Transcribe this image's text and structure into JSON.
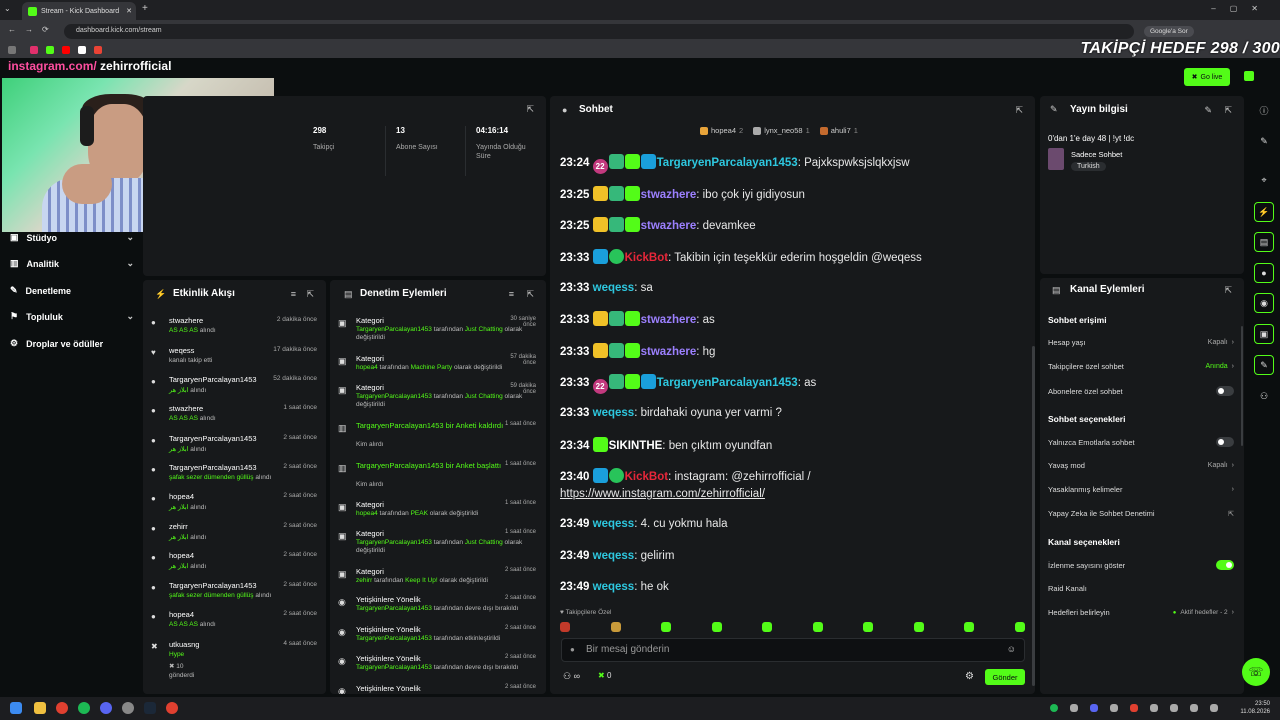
{
  "browser": {
    "tab_title": "Stream - Kick Dashboard",
    "url": "dashboard.kick.com/stream",
    "google_btn": "Google'a Sor"
  },
  "overlay": {
    "follower_goal": "TAKİPÇİ HEDEF 298 / 300",
    "insta_prefix": "instagram.com/",
    "insta_handle": "zehirrofficial"
  },
  "header": {
    "go_live": "Go live"
  },
  "sidebar": {
    "items": [
      {
        "label": "Stüdyo",
        "icon": "video-icon",
        "chevron": "⌄"
      },
      {
        "label": "Analitik",
        "icon": "chart-icon",
        "chevron": "⌄"
      },
      {
        "label": "Denetleme",
        "icon": "wrench-icon",
        "chevron": ""
      },
      {
        "label": "Topluluk",
        "icon": "users-icon",
        "chevron": "⌄"
      },
      {
        "label": "Droplar ve ödüller",
        "icon": "gift-icon",
        "chevron": ""
      }
    ]
  },
  "stats": [
    {
      "value": "298",
      "label": "Takipçi"
    },
    {
      "value": "13",
      "label": "Abone Sayısı"
    },
    {
      "value": "04:16:14",
      "label": "Yayında Olduğu Süre"
    }
  ],
  "activity": {
    "title": "Etkinlik Akışı",
    "items": [
      {
        "name": "stwazhere",
        "time": "2 dakika önce",
        "green": "AS AS AS",
        "rest": " alındı"
      },
      {
        "name": "weqess",
        "time": "17 dakika önce",
        "green": "",
        "rest": "kanalı takip etti"
      },
      {
        "name": "TargaryenParcalayan1453",
        "time": "52 dakika önce",
        "green": "ابلاز هر",
        "rest": " alındı"
      },
      {
        "name": "stwazhere",
        "time": "1 saat önce",
        "green": "AS AS AS",
        "rest": " alındı"
      },
      {
        "name": "TargaryenParcalayan1453",
        "time": "2 saat önce",
        "green": "ابلاز هر",
        "rest": " alındı"
      },
      {
        "name": "TargaryenParcalayan1453",
        "time": "2 saat önce",
        "green": "şafak sezer dümenden güllüş",
        "rest": " alındı"
      },
      {
        "name": "hopea4",
        "time": "2 saat önce",
        "green": "ابلاز هر",
        "rest": " alındı"
      },
      {
        "name": "zehirr",
        "time": "2 saat önce",
        "green": "ابلاز هر",
        "rest": " alındı"
      },
      {
        "name": "hopea4",
        "time": "2 saat önce",
        "green": "ابلاز هر",
        "rest": " alındı"
      },
      {
        "name": "TargaryenParcalayan1453",
        "time": "2 saat önce",
        "green": "şafak sezer dümenden güllüş",
        "rest": " alındı"
      },
      {
        "name": "hopea4",
        "time": "2 saat önce",
        "green": "AS AS AS",
        "rest": " alındı"
      },
      {
        "name": "utkuasng",
        "time": "4 saat önce",
        "green": "Hype",
        "rest": "",
        "extra1": "10",
        "extra2": "gönderdi"
      }
    ]
  },
  "moderation": {
    "title": "Denetim Eylemleri",
    "items": [
      {
        "title": "Kategori",
        "time": "30 saniye önce",
        "user": "TargaryenParcalayan1453",
        "mid": " tarafından ",
        "val": "Just Chatting",
        "end": " olarak değiştirildi"
      },
      {
        "title": "Kategori",
        "time": "57 dakika önce",
        "user": "hopea4",
        "mid": " tarafından ",
        "val": "Machine Party",
        "end": " olarak değiştirildi"
      },
      {
        "title": "Kategori",
        "time": "59 dakika önce",
        "user": "TargaryenParcalayan1453",
        "mid": " tarafından ",
        "val": "Just Chatting",
        "end": " olarak değiştirildi"
      },
      {
        "title": "TargaryenParcalayan1453 bir Anketi kaldırdı",
        "time": "1 saat önce",
        "sub": "Kim alırdı"
      },
      {
        "title": "TargaryenParcalayan1453 bir Anket başlattı",
        "time": "1 saat önce",
        "sub": "Kim alırdı"
      },
      {
        "title": "Kategori",
        "time": "1 saat önce",
        "user": "hopea4",
        "mid": " tarafından ",
        "val": "PEAK",
        "end": " olarak değiştirildi"
      },
      {
        "title": "Kategori",
        "time": "1 saat önce",
        "user": "TargaryenParcalayan1453",
        "mid": " tarafından ",
        "val": "Just Chatting",
        "end": " olarak değiştirildi"
      },
      {
        "title": "Kategori",
        "time": "2 saat önce",
        "user": "zehirr",
        "mid": " tarafından ",
        "val": "Keep It Up!",
        "end": " olarak değiştirildi"
      },
      {
        "title": "Yetişkinlere Yönelik",
        "time": "2 saat önce",
        "user": "TargaryenParcalayan1453",
        "mid": " tarafından devre dışı bırakıldı",
        "val": "",
        "end": ""
      },
      {
        "title": "Yetişkinlere Yönelik",
        "time": "2 saat önce",
        "user": "TargaryenParcalayan1453",
        "mid": " tarafından etkinleştirildi",
        "val": "",
        "end": ""
      },
      {
        "title": "Yetişkinlere Yönelik",
        "time": "2 saat önce",
        "user": "TargaryenParcalayan1453",
        "mid": " tarafından devre dışı bırakıldı",
        "val": "",
        "end": ""
      },
      {
        "title": "Yetişkinlere Yönelik",
        "time": "2 saat önce",
        "user": "",
        "mid": "",
        "val": "",
        "end": ""
      }
    ]
  },
  "chat": {
    "title": "Sohbet",
    "pinned": [
      {
        "name": "hopea4",
        "count": "2"
      },
      {
        "name": "lynx_neo58",
        "count": "1"
      },
      {
        "name": "ahuli7",
        "count": "1"
      }
    ],
    "messages": [
      {
        "time": "23:24",
        "badges": [
          "sub:22",
          "gift",
          "z",
          "blue"
        ],
        "user": "TargaryenParcalayan1453",
        "color": "u-cyan",
        "text": "Pajxkspwksjslqkxjsw"
      },
      {
        "time": "23:25",
        "badges": [
          "vip",
          "gift",
          "z"
        ],
        "user": "stwazhere",
        "color": "u-purple",
        "text": "ibo çok iyi gidiyosun"
      },
      {
        "time": "23:25",
        "badges": [
          "vip",
          "gift",
          "z"
        ],
        "user": "stwazhere",
        "color": "u-purple",
        "text": "devamkee"
      },
      {
        "time": "23:33",
        "badges": [
          "blue",
          "ver"
        ],
        "user": "KickBot",
        "color": "u-red",
        "text": "Takibin için teşekkür ederim hoşgeldin @weqess"
      },
      {
        "time": "23:33",
        "badges": [],
        "user": "weqess",
        "color": "u-cyan",
        "text": "sa"
      },
      {
        "time": "23:33",
        "badges": [
          "vip",
          "gift",
          "z"
        ],
        "user": "stwazhere",
        "color": "u-purple",
        "text": "as"
      },
      {
        "time": "23:33",
        "badges": [
          "vip",
          "gift",
          "z"
        ],
        "user": "stwazhere",
        "color": "u-purple",
        "text": "hg"
      },
      {
        "time": "23:33",
        "badges": [
          "sub:22",
          "gift",
          "z",
          "blue"
        ],
        "user": "TargaryenParcalayan1453",
        "color": "u-cyan",
        "text": "as"
      },
      {
        "time": "23:33",
        "badges": [],
        "user": "weqess",
        "color": "u-cyan",
        "text": "birdahaki oyuna yer varmi ?"
      },
      {
        "time": "23:34",
        "badges": [
          "z"
        ],
        "user": "SIKINTHE",
        "color": "u-white",
        "text": "ben çıktım oyundfan"
      },
      {
        "time": "23:40",
        "badges": [
          "blue",
          "ver"
        ],
        "user": "KickBot",
        "color": "u-red",
        "text": "instagram: @zehirrofficial /",
        "link": "https://www.instagram.com/zehirrofficial/"
      },
      {
        "time": "23:49",
        "badges": [],
        "user": "weqess",
        "color": "u-cyan",
        "text": "4. cu yokmu hala"
      },
      {
        "time": "23:49",
        "badges": [],
        "user": "weqess",
        "color": "u-cyan",
        "text": "gelirim"
      },
      {
        "time": "23:49",
        "badges": [],
        "user": "weqess",
        "color": "u-cyan",
        "text": "he ok"
      }
    ],
    "emote_label": "Takipçilere Özel",
    "input_placeholder": "Bir mesaj gönderin",
    "footer_count": "0",
    "footer_infinity": "∞",
    "send_label": "Gönder"
  },
  "stream_info": {
    "title": "Yayın bilgisi",
    "stream_title": "0'dan 1'e day 48 | !yt !dc",
    "category": "Sadece Sohbet",
    "language_tag": "Turkish"
  },
  "channel_actions": {
    "title": "Kanal Eylemleri",
    "sections": {
      "chat_access": "Sohbet erişimi",
      "chat_options": "Sohbet seçenekleri",
      "channel_options": "Kanal seçenekleri"
    },
    "rows": {
      "account_age": {
        "label": "Hesap yaşı",
        "value": "Kapalı"
      },
      "followers_only": {
        "label": "Takipçilere özel sohbet",
        "value": "Anında"
      },
      "subs_only": {
        "label": "Abonelere özel sohbet"
      },
      "emote_only": {
        "label": "Yalnızca Emotlarla sohbet"
      },
      "slow_mode": {
        "label": "Yavaş mod",
        "value": "Kapalı"
      },
      "banned_words": {
        "label": "Yasaklanmış kelimeler"
      },
      "ai_moderation": {
        "label": "Yapay Zeka ile Sohbet Denetimi"
      },
      "show_viewers": {
        "label": "İzlenme sayısını göster"
      },
      "raid": {
        "label": "Raid Kanalı"
      },
      "goals": {
        "label": "Hedefleri belirleyin",
        "value": "Aktif hedefler - 2"
      }
    }
  },
  "taskbar": {
    "time": "23:50",
    "date": "11.08.2026"
  },
  "colors": {
    "accent": "#53fc18",
    "panel": "#17191b",
    "bg": "#0b0e0f"
  }
}
